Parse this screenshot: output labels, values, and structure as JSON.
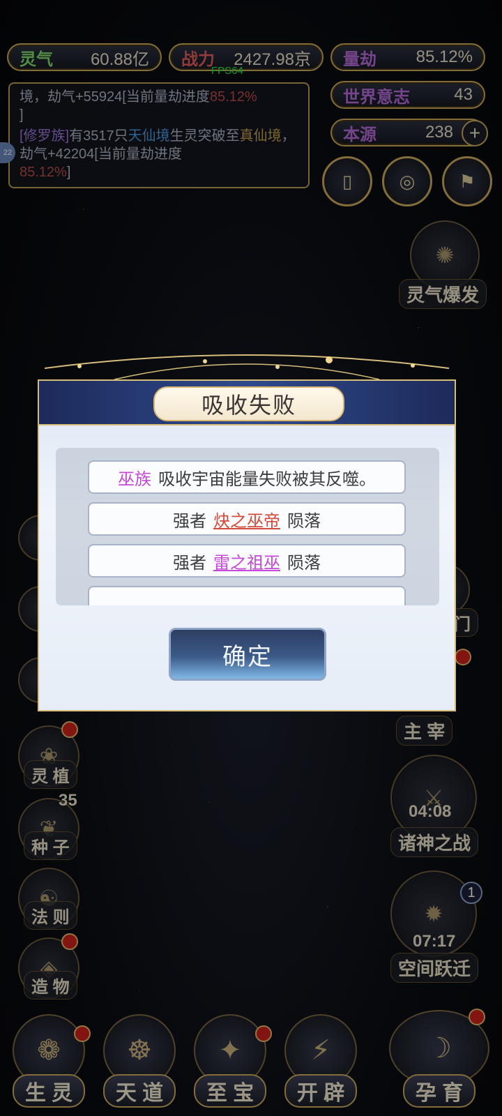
{
  "fps": "FPS64",
  "stats": {
    "lingqi": {
      "label": "灵气",
      "value": "60.88亿"
    },
    "zhanli": {
      "label": "战力",
      "value": "2427.98京"
    },
    "liangjie": {
      "label": "量劫",
      "value": "85.12%"
    },
    "shijie": {
      "label": "世界意志",
      "value": "43"
    },
    "benyuan": {
      "label": "本源",
      "value": "238"
    }
  },
  "log": {
    "line1_a": "境，劫气+55924[当前量劫进度",
    "line1_pct": "85.12%",
    "line1_b": "]",
    "line2_a": "[修罗族]",
    "line2_b": "有3517只",
    "line2_c": "天仙境",
    "line2_d": "生灵突破至",
    "line2_e": "真仙境",
    "line2_f": "，劫气+42204[当前量劫进度",
    "line2_pct": "85.12%",
    "line2_g": "]",
    "avatar_level": "22"
  },
  "right_menu": {
    "lingqi_burst": "灵气爆发",
    "zhuzai": "主 宰",
    "gods_war": "诸神之战",
    "gods_war_timer": "04:08",
    "space_jump": "空间跃迁",
    "space_jump_timer": "07:17",
    "space_jump_badge": "1",
    "door_partial": "门"
  },
  "left_menu": {
    "lingzhi": "灵 植",
    "zhongzi": "种 子",
    "zhongzi_badge": "35",
    "faze": "法 则",
    "zaowu": "造 物"
  },
  "bottom_nav": [
    "生 灵",
    "天 道",
    "至 宝",
    "开 辟",
    "孕 育"
  ],
  "modal": {
    "title": "吸收失败",
    "rows": [
      {
        "a": "巫族",
        "b": "吸收宇宙能量失败被其反噬。"
      },
      {
        "a": "强者",
        "b": "炔之巫帝",
        "c": "陨落"
      },
      {
        "a": "强者",
        "b": "雷之祖巫",
        "c": "陨落"
      }
    ],
    "confirm": "确定"
  },
  "colors": {
    "gold": "#c9a85a",
    "accent_purple": "#c548d6",
    "accent_red": "#d44a3c"
  }
}
